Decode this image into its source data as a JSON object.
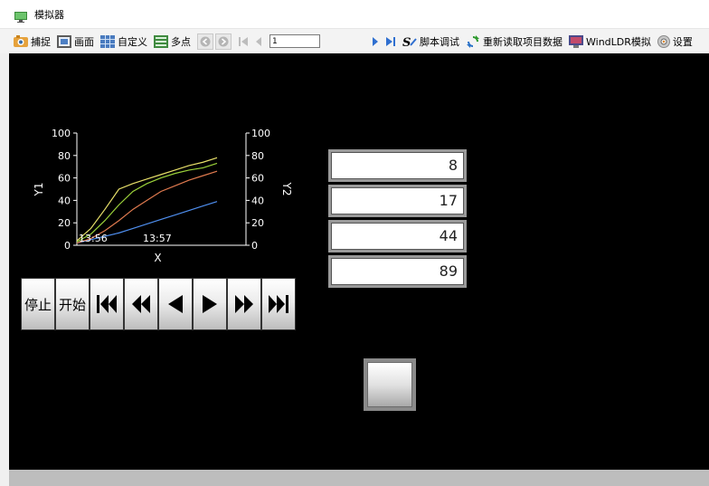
{
  "window": {
    "title": "模拟器"
  },
  "toolbar": {
    "capture": "捕捉",
    "screen": "画面",
    "custom": "自定义",
    "multipoint": "多点",
    "page_value": "1",
    "script_debug": "脚本调试",
    "reload_project": "重新读取项目数据",
    "windldr": "WindLDR模拟",
    "settings": "设置"
  },
  "chart_data": {
    "type": "line",
    "xlabel": "X",
    "ylabel": "Y1",
    "y2label": "Y2",
    "ylim": [
      0,
      100
    ],
    "y2lim": [
      0,
      100
    ],
    "yticks": [
      "100",
      "80",
      "60",
      "40",
      "20",
      "0"
    ],
    "y2ticks": [
      "100",
      "80",
      "60",
      "40",
      "20",
      "0"
    ],
    "xtick_labels": [
      "13:56",
      "13:57"
    ],
    "x": [
      0,
      1,
      2,
      3,
      4,
      5,
      6,
      7,
      8,
      9,
      10
    ],
    "series": [
      {
        "color": "#4f8ff0",
        "values": [
          2,
          5,
          8,
          11,
          15,
          19,
          23,
          27,
          31,
          35,
          39
        ]
      },
      {
        "color": "#e07a4f",
        "values": [
          2,
          6,
          13,
          22,
          32,
          40,
          48,
          53,
          58,
          62,
          66
        ]
      },
      {
        "color": "#9bd23a",
        "values": [
          3,
          10,
          22,
          36,
          48,
          55,
          60,
          64,
          67,
          69,
          73
        ]
      },
      {
        "color": "#e8e06a",
        "values": [
          4,
          15,
          32,
          50,
          55,
          59,
          63,
          67,
          71,
          74,
          78
        ]
      }
    ],
    "grid": false
  },
  "numeric_displays": [
    "8",
    "17",
    "44",
    "89"
  ],
  "controls": {
    "stop": "停止",
    "start": "开始"
  }
}
